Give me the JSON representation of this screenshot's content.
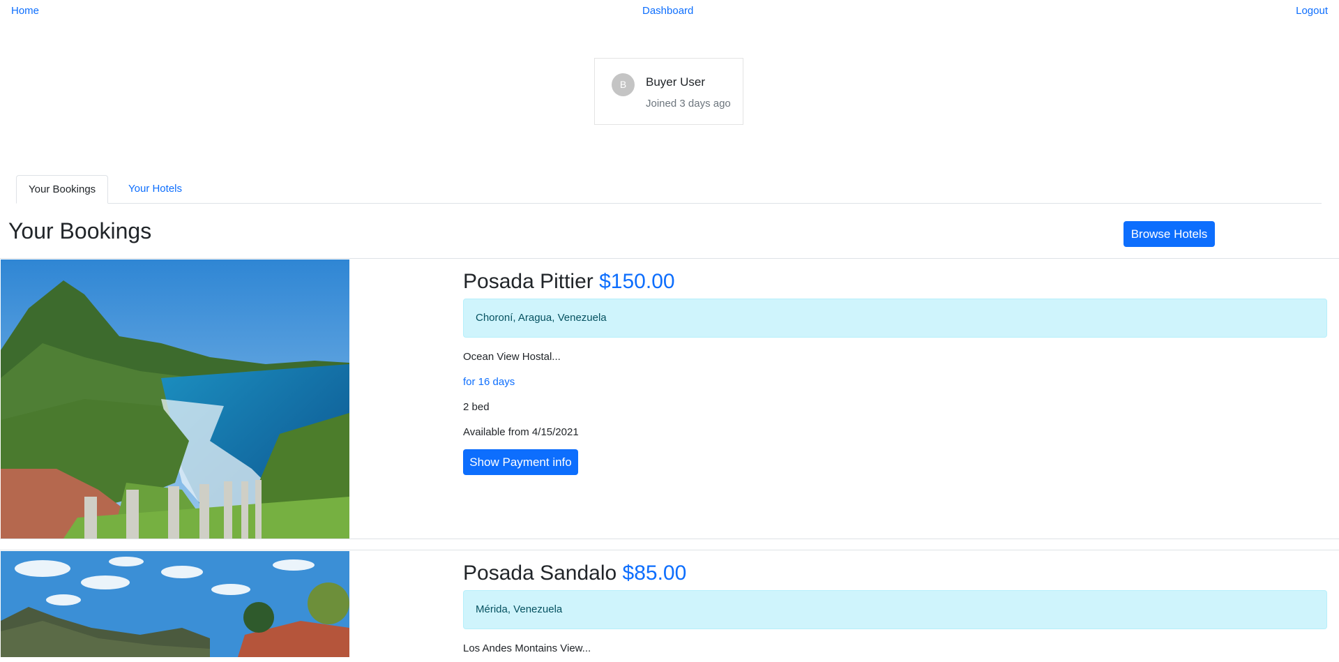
{
  "nav": {
    "home": "Home",
    "dashboard": "Dashboard",
    "logout": "Logout"
  },
  "profile": {
    "initial": "B",
    "name": "Buyer User",
    "joined": "Joined 3 days ago"
  },
  "tabs": [
    {
      "label": "Your Bookings",
      "active": true
    },
    {
      "label": "Your Hotels",
      "active": false
    }
  ],
  "section": {
    "title": "Your Bookings",
    "browse_button": "Browse Hotels"
  },
  "bookings": [
    {
      "name": "Posada Pittier",
      "price": "$150.00",
      "location": "Choroní, Aragua, Venezuela",
      "description": "Ocean View Hostal...",
      "duration": "for 16 days",
      "beds": "2 bed",
      "available": "Available from 4/15/2021",
      "payment_button": "Show Payment info"
    },
    {
      "name": "Posada Sandalo",
      "price": "$85.00",
      "location": "Mérida, Venezuela",
      "description": "Los Andes Montains View..."
    }
  ],
  "colors": {
    "primary": "#0d6efd",
    "info_bg": "#cff4fc",
    "info_text": "#055160",
    "muted": "#6c757d"
  }
}
